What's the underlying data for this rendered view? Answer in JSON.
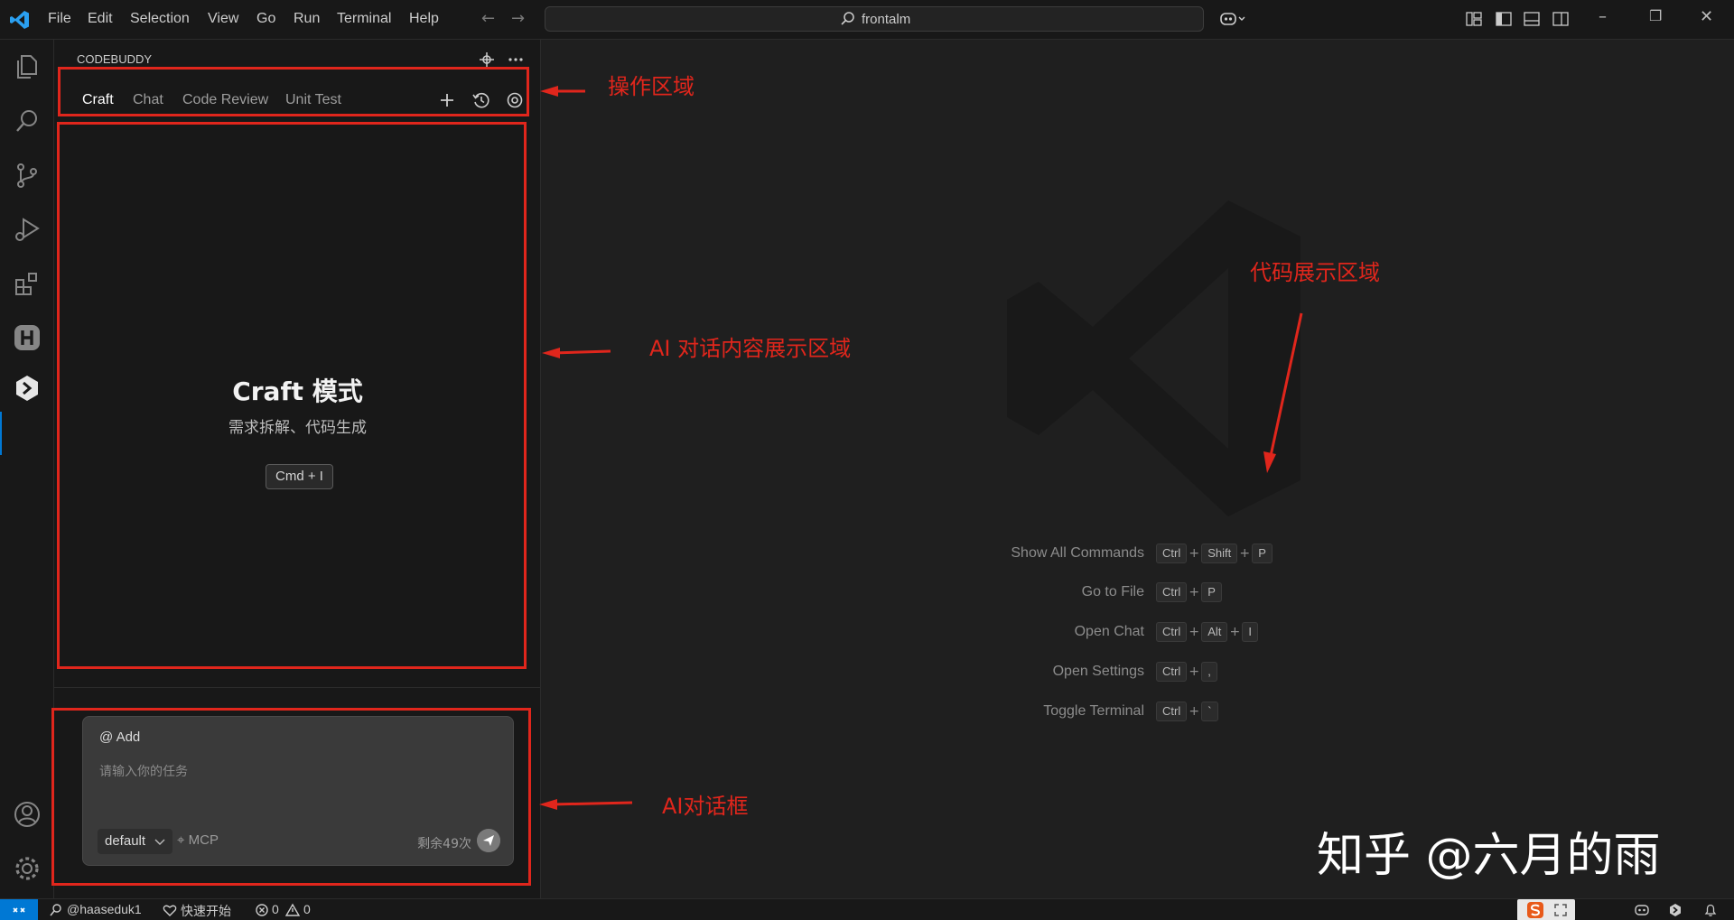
{
  "menu": {
    "file": "File",
    "edit": "Edit",
    "selection": "Selection",
    "view": "View",
    "go": "Go",
    "run": "Run",
    "terminal": "Terminal",
    "help": "Help"
  },
  "search": {
    "text": "frontalm"
  },
  "sidebar": {
    "title": "CODEBUDDY",
    "tabs": [
      "Craft",
      "Chat",
      "Code Review",
      "Unit Test"
    ],
    "empty_title": "Craft 模式",
    "empty_subtitle": "需求拆解、代码生成",
    "shortcut": "Cmd + I"
  },
  "chat_input": {
    "add_context": "@ Add",
    "placeholder": "请输入你的任务",
    "model": "default",
    "mcp": "MCP",
    "remaining": "剩余49次"
  },
  "editor": {
    "shortcuts": [
      {
        "label": "Show All Commands",
        "keys": [
          "Ctrl",
          "Shift",
          "P"
        ]
      },
      {
        "label": "Go to File",
        "keys": [
          "Ctrl",
          "P"
        ]
      },
      {
        "label": "Open Chat",
        "keys": [
          "Ctrl",
          "Alt",
          "I"
        ]
      },
      {
        "label": "Open Settings",
        "keys": [
          "Ctrl",
          ","
        ]
      },
      {
        "label": "Toggle Terminal",
        "keys": [
          "Ctrl",
          "`"
        ]
      }
    ]
  },
  "annotations": {
    "operation_area": "操作区域",
    "chat_content_area": "AI 对话内容展示区域",
    "code_area": "代码展示区域",
    "chat_box": "AI对话框"
  },
  "watermark": {
    "text": "知乎 @六月的雨"
  },
  "status": {
    "user": "@haaseduk1",
    "quick_start": "快速开始",
    "errors": "0",
    "warnings": "0"
  },
  "colors": {
    "accent": "#0078d4",
    "annotation": "#e0261c"
  }
}
